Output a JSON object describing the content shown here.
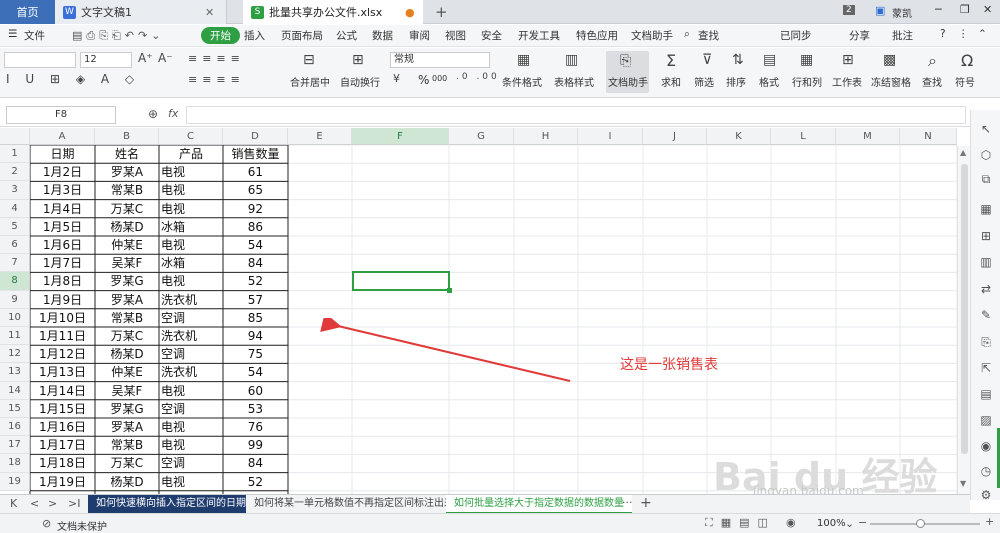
{
  "tabs": {
    "home": "首页",
    "doc": "文字文稿1",
    "sheet": "批量共享办公文件.xlsx",
    "badge": "2",
    "user": "蒙凯"
  },
  "ribbon_tabs": [
    "文件",
    "开始",
    "插入",
    "页面布局",
    "公式",
    "数据",
    "审阅",
    "视图",
    "安全",
    "开发工具",
    "特色应用",
    "文档助手",
    "查找"
  ],
  "ribbon_right": {
    "sync": "已同步",
    "share": "分享",
    "comment": "批注"
  },
  "toolbar": {
    "font_size": "12",
    "number_format": "常规",
    "merge": "合并居中",
    "wrap": "自动换行",
    "cond_format": "条件格式",
    "table_style": "表格样式",
    "doc_helper": "文档助手",
    "sum": "求和",
    "filter": "筛选",
    "sort": "排序",
    "format": "格式",
    "rowcol": "行和列",
    "sheet": "工作表",
    "freeze": "冻结窗格",
    "find": "查找",
    "symbol": "符号",
    "percent": "%",
    "thousands": "000"
  },
  "formula_bar": {
    "name_box": "F8",
    "fx": "fx"
  },
  "columns": [
    "A",
    "B",
    "C",
    "D",
    "E",
    "F",
    "G",
    "H",
    "I",
    "J",
    "K",
    "L",
    "M",
    "N"
  ],
  "table": {
    "headers": [
      "日期",
      "姓名",
      "产品",
      "销售数量"
    ],
    "rows": [
      [
        "1月2日",
        "罗某A",
        "电视",
        "61"
      ],
      [
        "1月3日",
        "常某B",
        "电视",
        "65"
      ],
      [
        "1月4日",
        "万某C",
        "电视",
        "92"
      ],
      [
        "1月5日",
        "杨某D",
        "冰箱",
        "86"
      ],
      [
        "1月6日",
        "仲某E",
        "电视",
        "54"
      ],
      [
        "1月7日",
        "吴某F",
        "冰箱",
        "84"
      ],
      [
        "1月8日",
        "罗某G",
        "电视",
        "52"
      ],
      [
        "1月9日",
        "罗某A",
        "洗衣机",
        "57"
      ],
      [
        "1月10日",
        "常某B",
        "空调",
        "85"
      ],
      [
        "1月11日",
        "万某C",
        "洗衣机",
        "94"
      ],
      [
        "1月12日",
        "杨某D",
        "空调",
        "75"
      ],
      [
        "1月13日",
        "仲某E",
        "洗衣机",
        "54"
      ],
      [
        "1月14日",
        "吴某F",
        "电视",
        "60"
      ],
      [
        "1月15日",
        "罗某G",
        "空调",
        "53"
      ],
      [
        "1月16日",
        "罗某A",
        "电视",
        "76"
      ],
      [
        "1月17日",
        "常某B",
        "电视",
        "99"
      ],
      [
        "1月18日",
        "万某C",
        "空调",
        "84"
      ],
      [
        "1月19日",
        "杨某D",
        "电视",
        "52"
      ]
    ]
  },
  "annotation": "这是一张销售表",
  "sheet_tabs": [
    "如何快速横向插入指定区间的日期",
    "如何将某一单元格数值不再指定区间标注出来",
    "如何批量选择大于指定数据的数据数量"
  ],
  "status": {
    "protect": "文档未保护",
    "zoom": "100%"
  },
  "watermark": {
    "brand": "Bai du 经验",
    "url": "jingyan.baidu.com"
  }
}
